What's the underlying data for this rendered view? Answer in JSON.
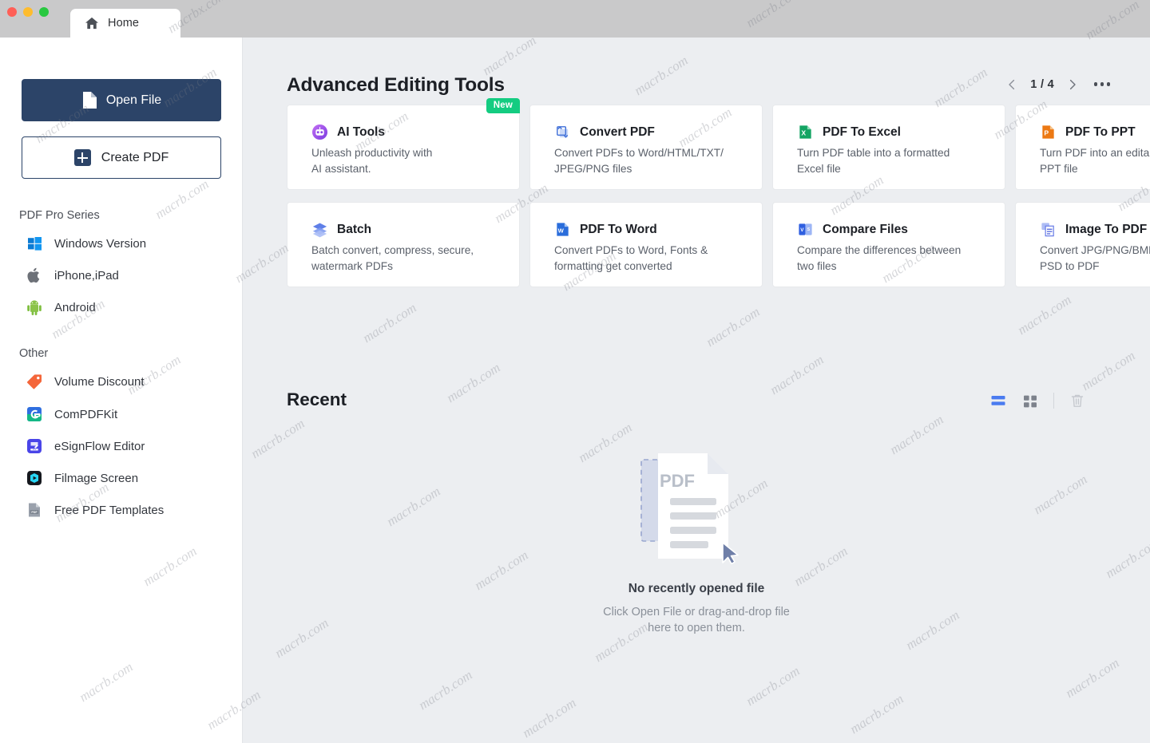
{
  "window": {
    "title": "Home",
    "traffic_lights": [
      "close",
      "minimize",
      "zoom"
    ]
  },
  "sidebar": {
    "open_file_label": "Open File",
    "create_pdf_label": "Create PDF",
    "sections": [
      {
        "heading": "PDF Pro Series",
        "items": [
          {
            "label": "Windows Version",
            "icon": "windows-icon"
          },
          {
            "label": "iPhone,iPad",
            "icon": "apple-icon"
          },
          {
            "label": "Android",
            "icon": "android-icon"
          }
        ]
      },
      {
        "heading": "Other",
        "items": [
          {
            "label": "Volume Discount",
            "icon": "price-tag-icon"
          },
          {
            "label": "ComPDFKit",
            "icon": "compdfkit-icon"
          },
          {
            "label": "eSignFlow Editor",
            "icon": "esignflow-icon"
          },
          {
            "label": "Filmage Screen",
            "icon": "filmage-icon"
          },
          {
            "label": "Free PDF Templates",
            "icon": "pdf-template-icon"
          }
        ]
      }
    ]
  },
  "tools": {
    "heading": "Advanced Editing Tools",
    "pagination": {
      "current": 1,
      "total": 4,
      "display": "1 / 4"
    },
    "more_label": "More options",
    "cards": [
      {
        "title": "AI Tools",
        "desc": "Unleash productivity with\nAI assistant.",
        "icon": "ai-robot-icon",
        "badge": "New"
      },
      {
        "title": "Convert PDF",
        "desc": "Convert PDFs to Word/HTML/TXT/\nJPEG/PNG files",
        "icon": "convert-pdf-icon",
        "badge": ""
      },
      {
        "title": "PDF To Excel",
        "desc": "Turn PDF table into a formatted\nExcel file",
        "icon": "excel-icon",
        "badge": ""
      },
      {
        "title": "PDF To PPT",
        "desc": "Turn PDF into an editable\nPPT file",
        "icon": "powerpoint-icon",
        "badge": ""
      },
      {
        "title": "Batch",
        "desc": "Batch convert, compress, secure,\nwatermark PDFs",
        "icon": "batch-layers-icon",
        "badge": ""
      },
      {
        "title": "PDF To Word",
        "desc": "Convert PDFs to Word, Fonts &\nformatting get converted",
        "icon": "word-icon",
        "badge": ""
      },
      {
        "title": "Compare Files",
        "desc": "Compare the differences between\ntwo files",
        "icon": "compare-files-icon",
        "badge": ""
      },
      {
        "title": "Image To PDF",
        "desc": "Convert JPG/PNG/BMP/\nPSD to PDF",
        "icon": "image-to-pdf-icon",
        "badge": ""
      }
    ]
  },
  "recent": {
    "heading": "Recent",
    "view_list_label": "List view",
    "view_grid_label": "Grid view",
    "delete_label": "Delete",
    "empty_title": "No recently opened file",
    "empty_desc": "Click Open File or drag-and-drop file\nhere to open them.",
    "art_label": "PDF"
  },
  "colors": {
    "primary": "#2c4468",
    "accent_badge": "#14cc81",
    "main_bg": "#eceef1",
    "sidebar_bg": "#ffffff",
    "titlebar_bg": "#c9c9ca",
    "active_view": "#4a7bf0"
  },
  "watermark": {
    "text": "macrb.com",
    "text_alt": "macrbx.com"
  }
}
